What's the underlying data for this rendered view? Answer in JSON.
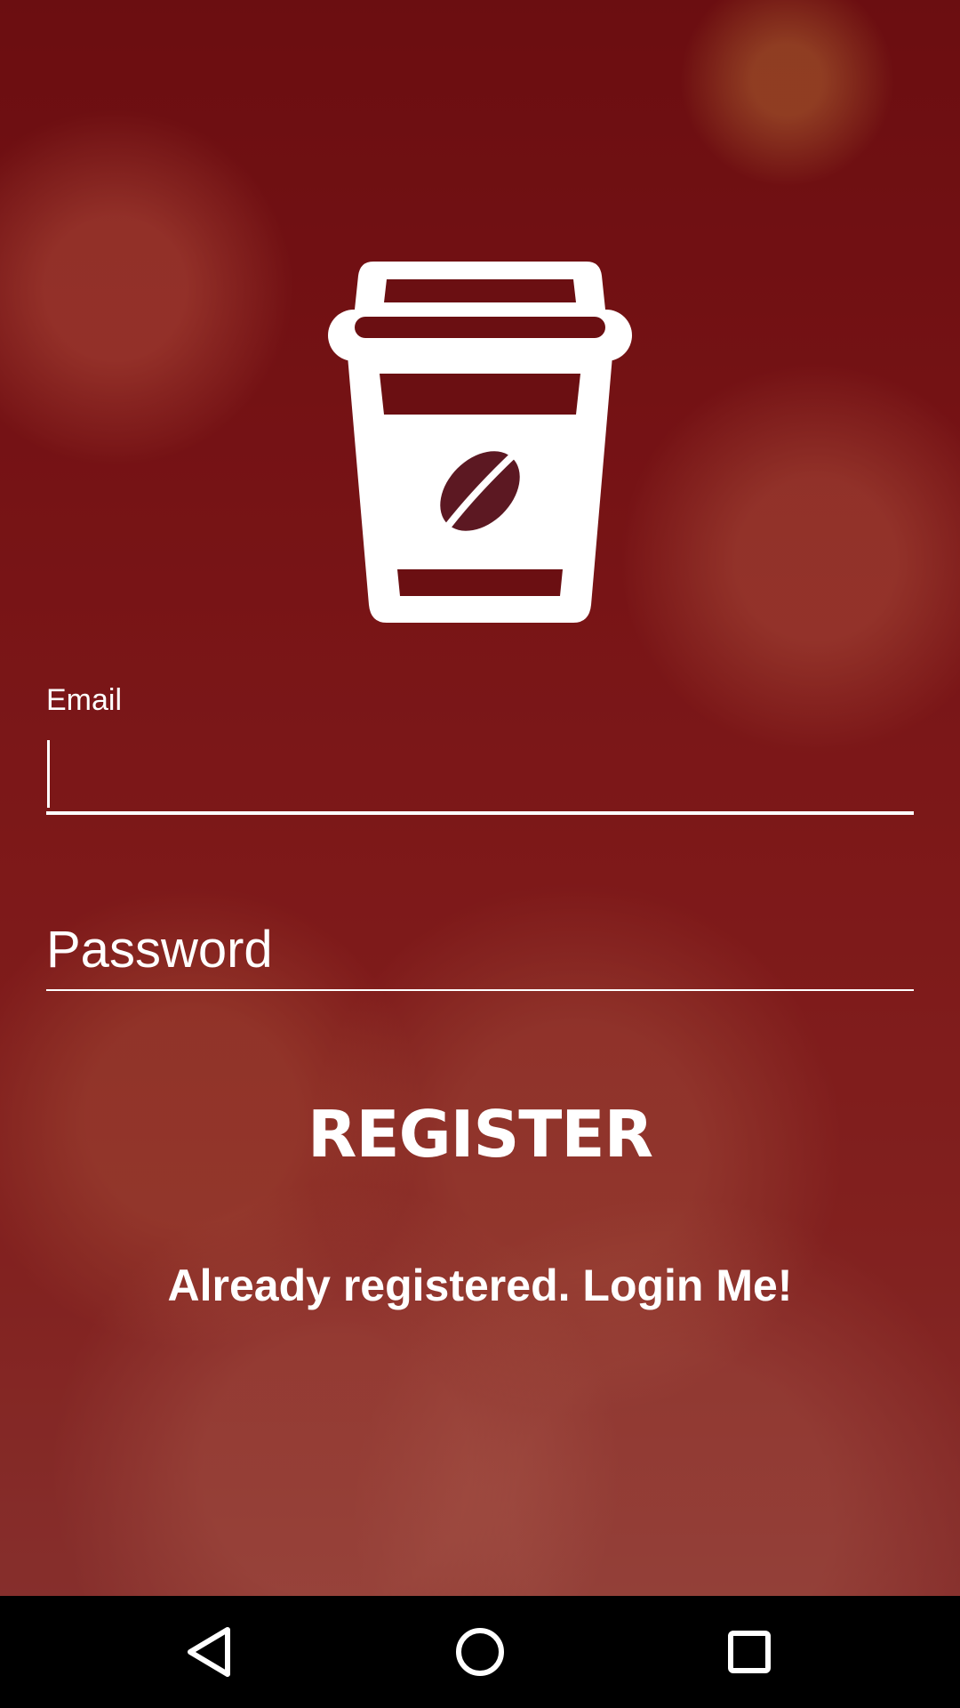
{
  "logo": {
    "icon": "coffee-cup-bean-icon"
  },
  "form": {
    "email": {
      "label": "Email",
      "value": ""
    },
    "password": {
      "placeholder": "Password",
      "value": ""
    }
  },
  "actions": {
    "register_label": "REGISTER",
    "login_label": "Already registered. Login Me!"
  },
  "nav": {
    "back_icon": "back-triangle-icon",
    "home_icon": "home-circle-icon",
    "recents_icon": "recents-square-icon"
  },
  "colors": {
    "overlay": "#7a1618",
    "text": "#ffffff",
    "nav_bar": "#000000"
  }
}
